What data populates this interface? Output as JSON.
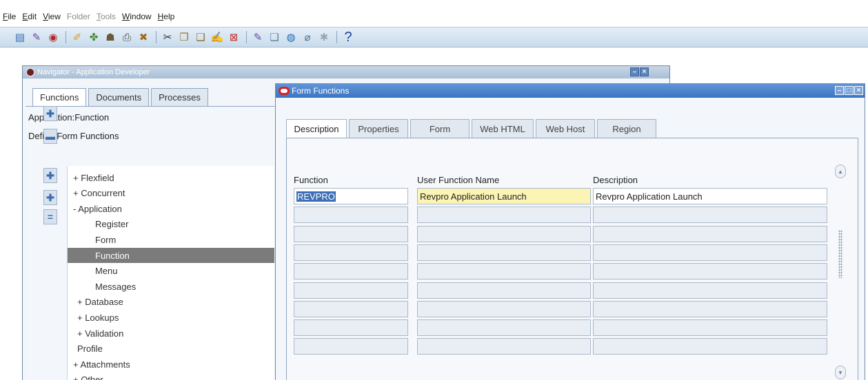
{
  "menu": [
    {
      "label": "File",
      "key": "F",
      "rest": "ile",
      "enabled": true
    },
    {
      "label": "Edit",
      "key": "E",
      "rest": "dit",
      "enabled": true
    },
    {
      "label": "View",
      "key": "V",
      "rest": "iew",
      "enabled": true
    },
    {
      "label": "Folder",
      "key": "",
      "rest": "Folder",
      "enabled": false
    },
    {
      "label": "Tools",
      "key": "T",
      "rest": "ools",
      "enabled": false
    },
    {
      "label": "Window",
      "key": "W",
      "rest": "indow",
      "enabled": true
    },
    {
      "label": "Help",
      "key": "H",
      "rest": "elp",
      "enabled": true
    }
  ],
  "toolbar": {
    "help_glyph": "?",
    "icons": [
      "new-record-icon",
      "find-icon",
      "navigator-icon",
      "save-icon",
      "next-step-icon",
      "switch-responsibility-icon",
      "print-icon",
      "close-form-icon",
      "cut-icon",
      "copy-icon",
      "paste-icon",
      "new-icon",
      "clear-record-icon",
      "edit-field-icon",
      "zoom-icon",
      "translations-icon",
      "attachments-icon",
      "folder-tools-icon",
      "help-icon"
    ]
  },
  "navigator": {
    "title": "Navigator - Application Developer",
    "tabs": [
      "Functions",
      "Documents",
      "Processes"
    ],
    "breadcrumb": "Application:Function",
    "current": "Define Form Functions",
    "tree": [
      {
        "label": "+ Flexfield",
        "level": 0,
        "selected": false
      },
      {
        "label": "+ Concurrent",
        "level": 0,
        "selected": false
      },
      {
        "label": "- Application",
        "level": 0,
        "selected": false
      },
      {
        "label": "Register",
        "level": 1,
        "selected": false
      },
      {
        "label": "Form",
        "level": 1,
        "selected": false
      },
      {
        "label": "Function",
        "level": 1,
        "selected": true
      },
      {
        "label": "Menu",
        "level": 1,
        "selected": false
      },
      {
        "label": "Messages",
        "level": 1,
        "selected": false
      },
      {
        "label": "+ Database",
        "level": 0.5,
        "selected": false
      },
      {
        "label": "+ Lookups",
        "level": 0.5,
        "selected": false
      },
      {
        "label": "+ Validation",
        "level": 0.5,
        "selected": false
      },
      {
        "label": "Profile",
        "level": 0.3,
        "selected": false
      },
      {
        "label": "+ Attachments",
        "level": 0,
        "selected": false
      },
      {
        "label": "+ Other",
        "level": 0,
        "selected": false
      }
    ],
    "side_buttons": [
      "expand-icon",
      "collapse-icon",
      "expand-branch-icon",
      "expand-all-icon",
      "collapse-all-icon"
    ]
  },
  "form_functions": {
    "title": "Form Functions",
    "tabs": [
      "Description",
      "Properties",
      "Form",
      "Web HTML",
      "Web Host",
      "Region"
    ],
    "columns": [
      "Function",
      "User Function Name",
      "Description"
    ],
    "rows": [
      [
        "REVPRO",
        "Revpro Application Launch",
        "Revpro Application Launch"
      ],
      [
        "",
        "",
        ""
      ],
      [
        "",
        "",
        ""
      ],
      [
        "",
        "",
        ""
      ],
      [
        "",
        "",
        ""
      ],
      [
        "",
        "",
        ""
      ],
      [
        "",
        "",
        ""
      ],
      [
        "",
        "",
        ""
      ],
      [
        "",
        "",
        ""
      ]
    ]
  }
}
